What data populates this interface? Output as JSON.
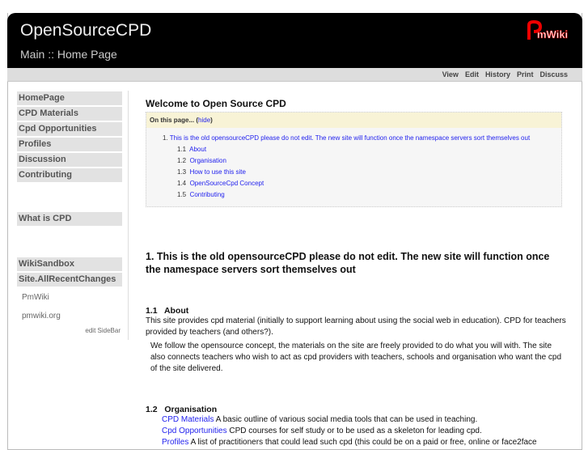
{
  "header": {
    "site_title": "OpenSourceCPD",
    "group_title": "Main :: Home Page",
    "logo_text": "PmWiki"
  },
  "actions": [
    "View",
    "Edit",
    "History",
    "Print",
    "Discuss"
  ],
  "sidebar": {
    "group1": [
      "HomePage",
      "CPD Materials",
      "Cpd Opportunities",
      "Profiles",
      "Discussion",
      "Contributing"
    ],
    "group2": [
      "What is CPD"
    ],
    "group3": [
      "WikiSandbox",
      "Site.AllRecentChanges"
    ],
    "links": [
      "PmWiki",
      "pmwiki.org"
    ],
    "edit": "edit SideBar"
  },
  "main": {
    "title": "Welcome to Open Source CPD",
    "toc": {
      "heading": "On this page...",
      "hide": "hide",
      "item1_num": "1.",
      "item1": "This is the old opensourceCPD please do not edit. The new site will function once the namespace servers sort themselves out",
      "subs": [
        {
          "num": "1.1",
          "label": "About"
        },
        {
          "num": "1.2",
          "label": "Organisation"
        },
        {
          "num": "1.3",
          "label": "How to use this site"
        },
        {
          "num": "1.4",
          "label": "OpenSourceCpd Concept"
        },
        {
          "num": "1.5",
          "label": "Contributing"
        }
      ]
    },
    "h1": "1.  This is the old opensourceCPD please do not edit. The new site will function once the namespace servers sort themselves out",
    "about_h": "1.1   About",
    "about_p1": "This site provides cpd material (initially to support learning about using the social web in education). CPD for teachers provided by teachers (and others?).",
    "about_p2": "We follow the opensource concept, the materials on the site are freely provided to do what you will with. The site also connects teachers who wish to act as cpd providers with teachers, schools and organisation who want the cpd of the site delivered.",
    "org_h": "1.2   Organisation",
    "org": [
      {
        "link": "CPD Materials",
        "text": " A basic outline of various social media tools that can be used in teaching."
      },
      {
        "link": "Cpd Opportunities",
        "text": " CPD courses for self study or to be used as a skeleton for leading cpd."
      },
      {
        "link": "Profiles",
        "text": " A list of practitioners that could lead such cpd (this could be on a paid or free, online or face2face"
      }
    ]
  }
}
